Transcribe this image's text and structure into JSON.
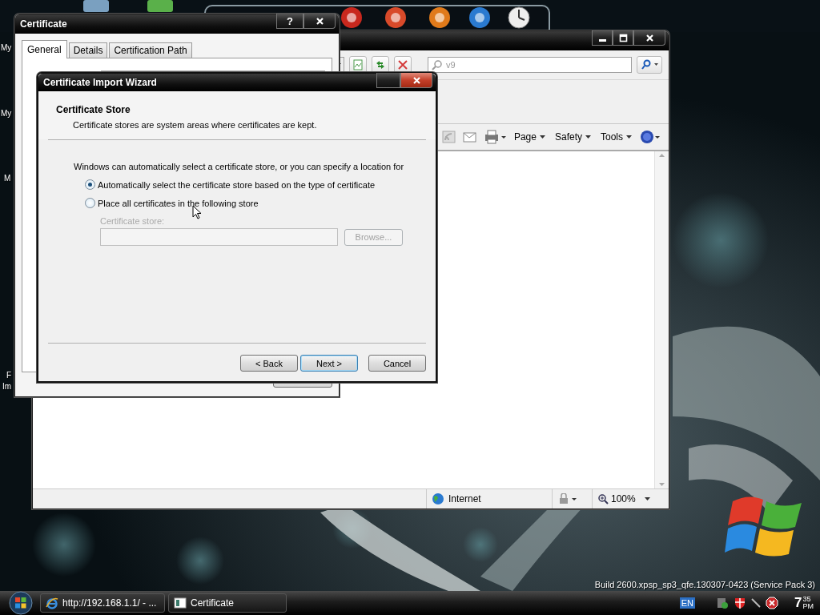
{
  "desktop": {
    "icon_labels": [
      "My",
      "My",
      "M",
      "F",
      "Im"
    ],
    "build_text": "Build 2600.xpsp_sp3_qfe.130307-0423 (Service Pack 3)"
  },
  "browser": {
    "search": {
      "value": "v9"
    },
    "commands": [
      {
        "label": "Page"
      },
      {
        "label": "Safety"
      },
      {
        "label": "Tools"
      }
    ],
    "zone": "Internet",
    "zoom": "100%"
  },
  "certificate": {
    "title": "Certificate",
    "help_button": "?",
    "tabs": [
      {
        "label": "General",
        "selected": true
      },
      {
        "label": "Details",
        "selected": false
      },
      {
        "label": "Certification Path",
        "selected": false
      }
    ]
  },
  "wizard": {
    "title": "Certificate Import Wizard",
    "heading": "Certificate Store",
    "subheading": "Certificate stores are system areas where certificates are kept.",
    "intro": "Windows can automatically select a certificate store, or you can specify a location for",
    "options": [
      {
        "label": "Automatically select the certificate store based on the type of certificate",
        "selected": true
      },
      {
        "label": "Place all certificates in the following store",
        "selected": false
      }
    ],
    "store": {
      "label": "Certificate store:",
      "browse": "Browse...",
      "disabled": true
    },
    "buttons": [
      {
        "label": "< Back",
        "focused": false
      },
      {
        "label": "Next >",
        "focused": true
      },
      {
        "label": "Cancel",
        "focused": false
      }
    ]
  },
  "taskbar": {
    "tasks": [
      {
        "label": "http://192.168.1.1/ - ...",
        "kind": "browser"
      },
      {
        "label": "Certificate",
        "kind": "certificate"
      }
    ],
    "language": "EN",
    "clock": {
      "hour": "7",
      "minutes": "35",
      "period": "PM"
    }
  }
}
